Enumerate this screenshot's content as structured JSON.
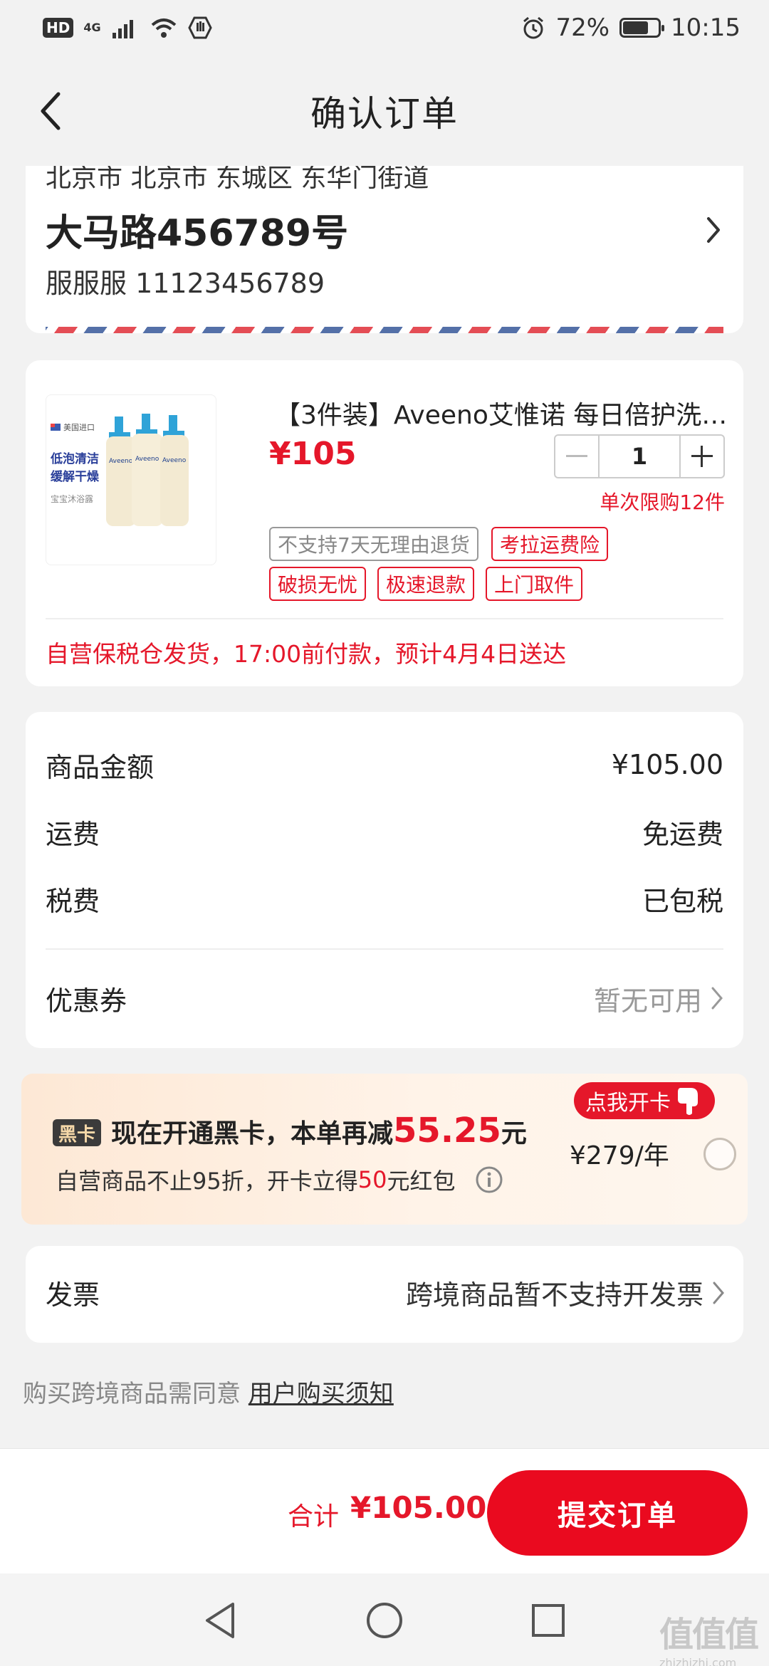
{
  "status_bar": {
    "hd": "HD",
    "network": "4G",
    "battery_percent": "72%",
    "battery_level": 0.72,
    "time": "10:15"
  },
  "nav": {
    "title": "确认订单",
    "back_icon": "chevron-left-icon"
  },
  "address": {
    "region": "北京市 北京市 东城区 东华门街道",
    "street": "大马路456789号",
    "contact": "服服服 11123456789"
  },
  "product": {
    "name": "【3件装】Aveeno艾惟诺 每日倍护洗…",
    "price": "¥105",
    "quantity": "1",
    "limit": "单次限购12件",
    "image_text": {
      "origin": "美国进口",
      "line1": "低泡清洁",
      "line2": "缓解干燥",
      "line3": "宝宝沐浴露",
      "brand": "Aveeno"
    },
    "tags": {
      "no_return": "不支持7天无理由退货",
      "shipping_insurance": "考拉运费险",
      "damage": "破损无忧",
      "fast_refund": "极速退款",
      "pickup": "上门取件"
    },
    "delivery": "自营保税仓发货，17:00前付款，预计4月4日送达"
  },
  "summary": {
    "goods_label": "商品金额",
    "goods_value": "¥105.00",
    "shipping_label": "运费",
    "shipping_value": "免运费",
    "tax_label": "税费",
    "tax_value": "已包税",
    "coupon_label": "优惠券",
    "coupon_value": "暂无可用"
  },
  "vip": {
    "badge": "黑卡",
    "title_prefix": "现在开通黑卡，本单再减",
    "amount": "55.25",
    "title_suffix": "元",
    "sub_prefix": "自营商品不止95折，开卡立得",
    "sub_amount": "50",
    "sub_suffix": "元红包",
    "open_label": "点我开卡",
    "price": "¥279/年"
  },
  "invoice": {
    "label": "发票",
    "value": "跨境商品暂不支持开发票"
  },
  "agreement": {
    "text": "购买跨境商品需同意 ",
    "link": "用户购买须知"
  },
  "bottom": {
    "total_label": "合计",
    "total_value": "¥105.00",
    "submit_label": "提交订单"
  },
  "watermark": {
    "logo": "值值值",
    "url": "zhizhizhi.com"
  },
  "colors": {
    "accent": "#e5172a",
    "submit": "#ea0a1f",
    "vip_bg": "#fde8d5"
  }
}
